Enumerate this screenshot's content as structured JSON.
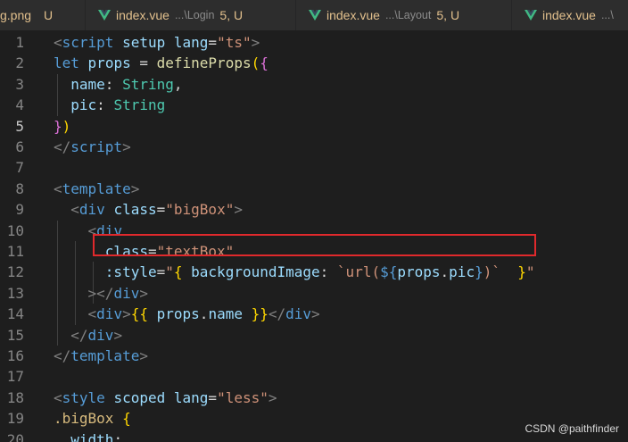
{
  "tabs": [
    {
      "name": "g.png",
      "path": "",
      "status": "U"
    },
    {
      "name": "index.vue",
      "path": "...\\Login",
      "status": "5, U"
    },
    {
      "name": "index.vue",
      "path": "...\\Layout",
      "status": "5, U"
    },
    {
      "name": "index.vue",
      "path": "...\\",
      "status": ""
    }
  ],
  "lines": [
    {
      "n": "1",
      "tokens": [
        [
          "tk-punct",
          "<"
        ],
        [
          "tk-tag",
          "script"
        ],
        [
          "tk-plain",
          " "
        ],
        [
          "tk-attr",
          "setup"
        ],
        [
          "tk-plain",
          " "
        ],
        [
          "tk-attr",
          "lang"
        ],
        [
          "tk-plain",
          "="
        ],
        [
          "tk-str",
          "\"ts\""
        ],
        [
          "tk-punct",
          ">"
        ]
      ]
    },
    {
      "n": "2",
      "tokens": [
        [
          "tk-kw",
          "let"
        ],
        [
          "tk-plain",
          " "
        ],
        [
          "tk-attr",
          "props"
        ],
        [
          "tk-plain",
          " = "
        ],
        [
          "tk-fn",
          "defineProps"
        ],
        [
          "tk-brace1",
          "("
        ],
        [
          "tk-brace2",
          "{"
        ]
      ]
    },
    {
      "n": "3",
      "tokens": [
        [
          "tk-plain",
          "  "
        ],
        [
          "tk-attr",
          "name"
        ],
        [
          "tk-plain",
          ": "
        ],
        [
          "tk-type",
          "String"
        ],
        [
          "tk-plain",
          ","
        ]
      ]
    },
    {
      "n": "4",
      "tokens": [
        [
          "tk-plain",
          "  "
        ],
        [
          "tk-attr",
          "pic"
        ],
        [
          "tk-plain",
          ": "
        ],
        [
          "tk-type",
          "String"
        ]
      ]
    },
    {
      "n": "5",
      "tokens": [
        [
          "tk-brace2",
          "}"
        ],
        [
          "tk-brace1",
          ")"
        ]
      ]
    },
    {
      "n": "6",
      "tokens": [
        [
          "tk-punct",
          "</"
        ],
        [
          "tk-tag",
          "script"
        ],
        [
          "tk-punct",
          ">"
        ]
      ]
    },
    {
      "n": "7",
      "tokens": []
    },
    {
      "n": "8",
      "tokens": [
        [
          "tk-punct",
          "<"
        ],
        [
          "tk-tag",
          "template"
        ],
        [
          "tk-punct",
          ">"
        ]
      ]
    },
    {
      "n": "9",
      "tokens": [
        [
          "tk-plain",
          "  "
        ],
        [
          "tk-punct",
          "<"
        ],
        [
          "tk-tag",
          "div"
        ],
        [
          "tk-plain",
          " "
        ],
        [
          "tk-attr",
          "class"
        ],
        [
          "tk-plain",
          "="
        ],
        [
          "tk-str",
          "\"bigBox\""
        ],
        [
          "tk-punct",
          ">"
        ]
      ]
    },
    {
      "n": "10",
      "tokens": [
        [
          "tk-plain",
          "    "
        ],
        [
          "tk-punct",
          "<"
        ],
        [
          "tk-tag",
          "div"
        ]
      ]
    },
    {
      "n": "11",
      "tokens": [
        [
          "tk-plain",
          "      "
        ],
        [
          "tk-attr",
          "class"
        ],
        [
          "tk-plain",
          "="
        ],
        [
          "tk-str",
          "\"textBox\""
        ]
      ]
    },
    {
      "n": "12",
      "tokens": [
        [
          "tk-plain",
          "      "
        ],
        [
          "tk-attr",
          ":style"
        ],
        [
          "tk-plain",
          "="
        ],
        [
          "tk-str",
          "\""
        ],
        [
          "tk-brace1",
          "{"
        ],
        [
          "tk-plain",
          " "
        ],
        [
          "tk-attr",
          "backgroundImage"
        ],
        [
          "tk-plain",
          ": "
        ],
        [
          "tk-str",
          "`url("
        ],
        [
          "tk-kw",
          "${"
        ],
        [
          "tk-attr",
          "props"
        ],
        [
          "tk-plain",
          "."
        ],
        [
          "tk-attr",
          "pic"
        ],
        [
          "tk-kw",
          "}"
        ],
        [
          "tk-str",
          ")`"
        ],
        [
          "tk-plain",
          "  "
        ],
        [
          "tk-brace1",
          "}"
        ],
        [
          "tk-str",
          "\""
        ]
      ]
    },
    {
      "n": "13",
      "tokens": [
        [
          "tk-plain",
          "    "
        ],
        [
          "tk-punct",
          "></"
        ],
        [
          "tk-tag",
          "div"
        ],
        [
          "tk-punct",
          ">"
        ]
      ]
    },
    {
      "n": "14",
      "tokens": [
        [
          "tk-plain",
          "    "
        ],
        [
          "tk-punct",
          "<"
        ],
        [
          "tk-tag",
          "div"
        ],
        [
          "tk-punct",
          ">"
        ],
        [
          "tk-brace1",
          "{{"
        ],
        [
          "tk-plain",
          " "
        ],
        [
          "tk-attr",
          "props"
        ],
        [
          "tk-plain",
          "."
        ],
        [
          "tk-attr",
          "name"
        ],
        [
          "tk-plain",
          " "
        ],
        [
          "tk-brace1",
          "}}"
        ],
        [
          "tk-punct",
          "</"
        ],
        [
          "tk-tag",
          "div"
        ],
        [
          "tk-punct",
          ">"
        ]
      ]
    },
    {
      "n": "15",
      "tokens": [
        [
          "tk-plain",
          "  "
        ],
        [
          "tk-punct",
          "</"
        ],
        [
          "tk-tag",
          "div"
        ],
        [
          "tk-punct",
          ">"
        ]
      ]
    },
    {
      "n": "16",
      "tokens": [
        [
          "tk-punct",
          "</"
        ],
        [
          "tk-tag",
          "template"
        ],
        [
          "tk-punct",
          ">"
        ]
      ]
    },
    {
      "n": "17",
      "tokens": []
    },
    {
      "n": "18",
      "tokens": [
        [
          "tk-punct",
          "<"
        ],
        [
          "tk-tag",
          "style"
        ],
        [
          "tk-plain",
          " "
        ],
        [
          "tk-attr",
          "scoped"
        ],
        [
          "tk-plain",
          " "
        ],
        [
          "tk-attr",
          "lang"
        ],
        [
          "tk-plain",
          "="
        ],
        [
          "tk-str",
          "\"less\""
        ],
        [
          "tk-punct",
          ">"
        ]
      ]
    },
    {
      "n": "19",
      "tokens": [
        [
          "tk-cls",
          ".bigBox"
        ],
        [
          "tk-plain",
          " "
        ],
        [
          "tk-brace1",
          "{"
        ]
      ]
    },
    {
      "n": "20",
      "tokens": [
        [
          "tk-plain",
          "  "
        ],
        [
          "tk-attr",
          "width"
        ],
        [
          "tk-plain",
          ":"
        ]
      ]
    }
  ],
  "active_line": "5",
  "watermark": "CSDN @paithfinder",
  "colors": {
    "highlight_border": "#e0292c",
    "tab_modified": "#e2c08d",
    "vue_logo": "#41b883"
  }
}
